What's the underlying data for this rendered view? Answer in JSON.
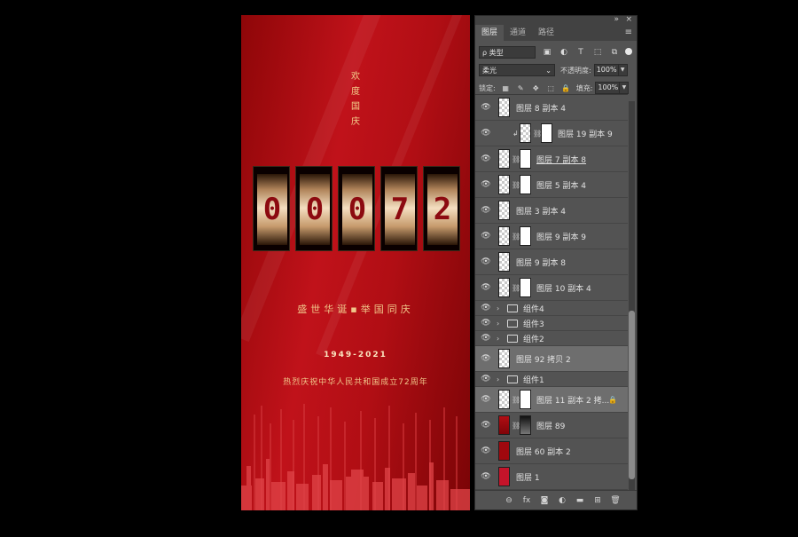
{
  "poster": {
    "title_chars": [
      "欢",
      "度",
      "国",
      "庆"
    ],
    "digits": [
      "0",
      "0",
      "0",
      "7",
      "2"
    ],
    "tagline": "盛世华诞▪举国同庆",
    "years": "1949-2021",
    "subtitle": "热烈庆祝中华人民共和国成立72周年"
  },
  "panel": {
    "collapse_glyph": "»",
    "close_glyph": "×",
    "tabs": [
      {
        "label": "图层",
        "active": true
      },
      {
        "label": "通道",
        "active": false
      },
      {
        "label": "路径",
        "active": false
      }
    ],
    "menu_glyph": "≡",
    "filter": {
      "kind": "ρ 类型",
      "icons": [
        "image-filter-icon",
        "adjustment-filter-icon",
        "type-filter-icon",
        "shape-filter-icon",
        "smart-object-filter-icon"
      ],
      "icon_glyphs": [
        "▣",
        "◐",
        "T",
        "⬚",
        "⧉"
      ]
    },
    "blend_mode": "柔光",
    "opacity_label": "不透明度:",
    "opacity_value": "100%",
    "lock_label": "锁定:",
    "lock_glyphs": [
      "▦",
      "✎",
      "✥",
      "⬚",
      "🔒"
    ],
    "fill_label": "填充:",
    "fill_value": "100%",
    "eye_glyph": "👁",
    "layers": [
      {
        "name": "图层 8 副本 4",
        "type": "layer",
        "thumb": "checker",
        "mask": false
      },
      {
        "name": "图层 19 副本 9",
        "type": "layer",
        "thumb": "checker",
        "mask": true,
        "clip": true
      },
      {
        "name": "图层 7 副本 8",
        "type": "layer",
        "thumb": "checker",
        "mask": true,
        "underlined": true
      },
      {
        "name": "图层 5 副本 4",
        "type": "layer",
        "thumb": "checker",
        "mask": true
      },
      {
        "name": "图层 3 副本 4",
        "type": "layer",
        "thumb": "checker",
        "mask": false
      },
      {
        "name": "图层 9 副本 9",
        "type": "layer",
        "thumb": "checker",
        "mask": true
      },
      {
        "name": "图层 9 副本 8",
        "type": "layer",
        "thumb": "checker",
        "mask": false
      },
      {
        "name": "图层 10 副本 4",
        "type": "layer",
        "thumb": "checker",
        "mask": true
      },
      {
        "name": "组件4",
        "type": "group"
      },
      {
        "name": "组件3",
        "type": "group"
      },
      {
        "name": "组件2",
        "type": "group"
      },
      {
        "name": "图层 92 拷贝 2",
        "type": "layer",
        "thumb": "checker",
        "mask": false,
        "selected": true
      },
      {
        "name": "组件1",
        "type": "group"
      },
      {
        "name": "图层 11 副本 2 拷...",
        "type": "layer",
        "thumb": "checker",
        "mask": true,
        "selected": true,
        "locked": true
      },
      {
        "name": "图层 89",
        "type": "layer",
        "thumb": "red2",
        "mask": true,
        "mask_dark": true
      },
      {
        "name": "图层 60 副本 2",
        "type": "layer",
        "thumb": "red",
        "mask": false
      },
      {
        "name": "图层 1",
        "type": "layer",
        "thumb": "pink",
        "mask": false
      }
    ],
    "bottom_icons": [
      {
        "name": "link-layers-icon",
        "glyph": "⊖"
      },
      {
        "name": "fx-icon",
        "glyph": "fx"
      },
      {
        "name": "add-mask-icon",
        "glyph": "◙"
      },
      {
        "name": "adjustment-layer-icon",
        "glyph": "◐"
      },
      {
        "name": "new-group-icon",
        "glyph": "▬"
      },
      {
        "name": "new-layer-icon",
        "glyph": "⊞"
      },
      {
        "name": "delete-layer-icon",
        "glyph": "🗑"
      }
    ]
  }
}
